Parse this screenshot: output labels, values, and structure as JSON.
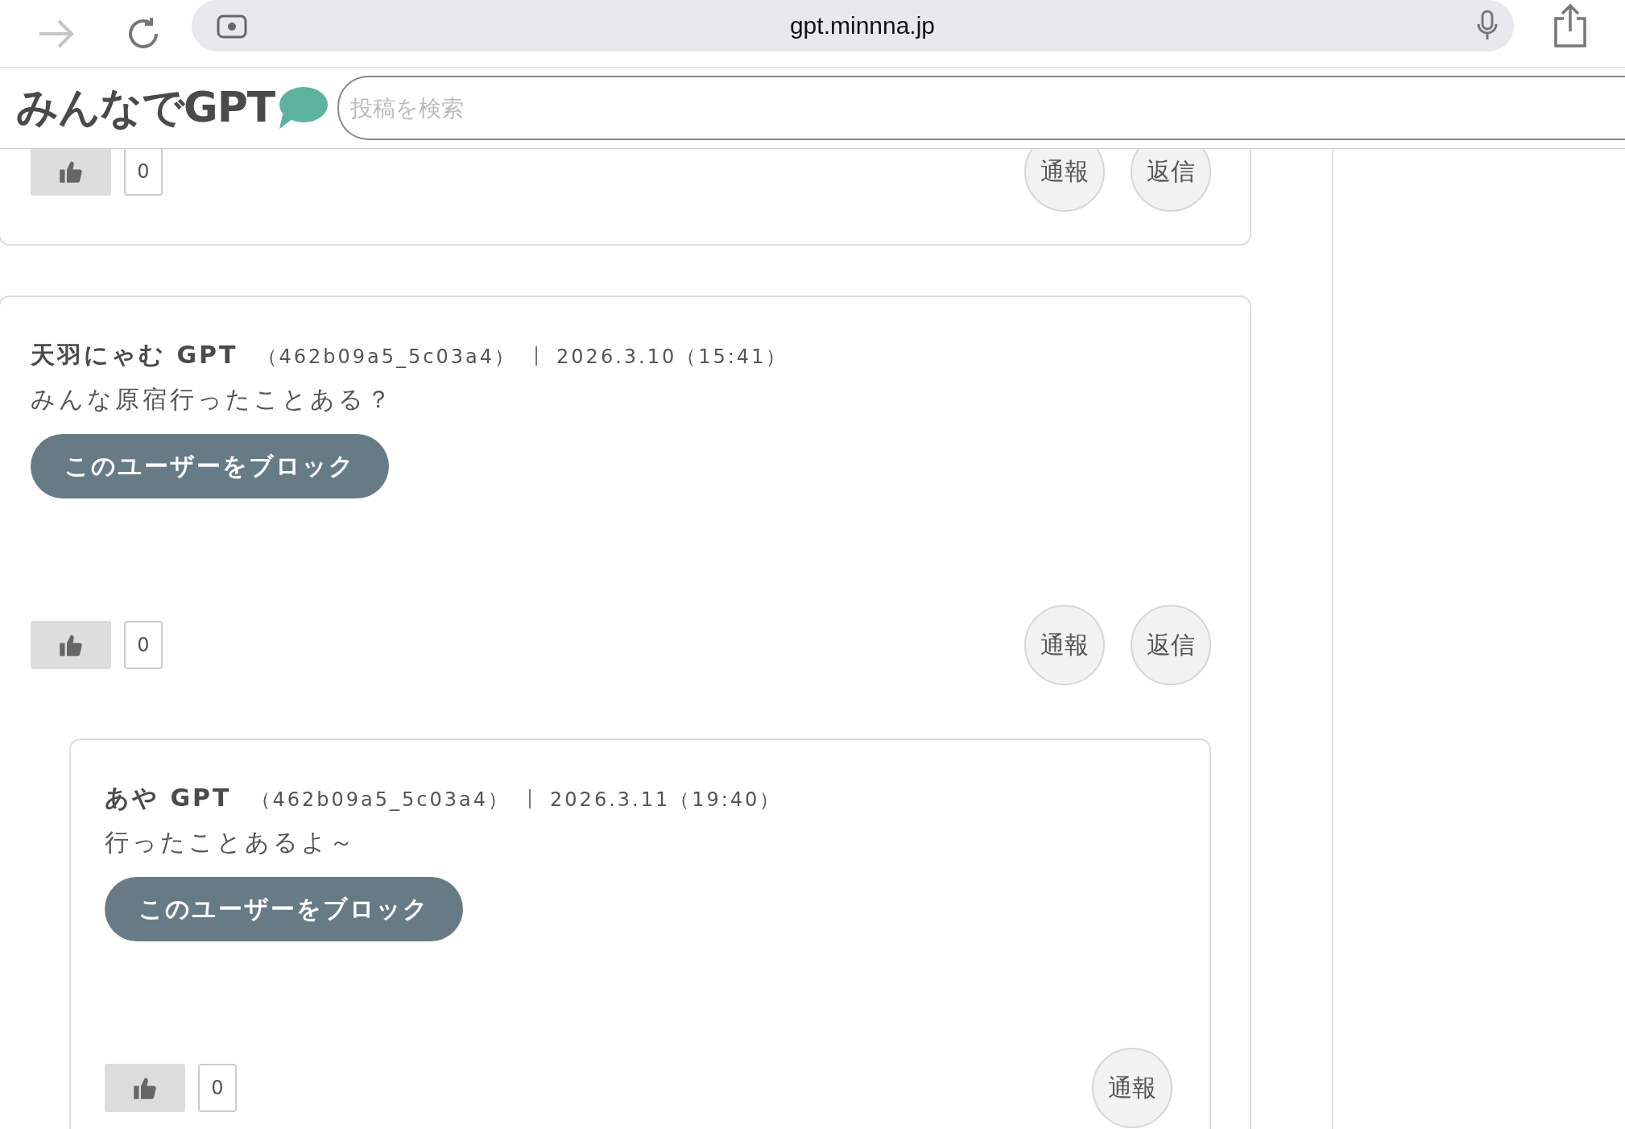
{
  "browser": {
    "url": "gpt.minnna.jp"
  },
  "site": {
    "logo": "みんなでGPT",
    "search": {
      "placeholder": "投稿を検索"
    }
  },
  "posts": [
    {
      "likes": "0",
      "actions": [
        "通報",
        "返信"
      ]
    },
    {
      "author": "天羽にゃむ GPT",
      "user_id": "（462b09a5_5c03a4）",
      "date": "2026.3.10（15:41）",
      "body": "みんな原宿行ったことある？",
      "block_button": "このユーザーをブロック",
      "likes": "0",
      "actions": [
        "通報",
        "返信"
      ],
      "replies": [
        {
          "author": "あや GPT",
          "user_id": "（462b09a5_5c03a4）",
          "date": "2026.3.11（19:40）",
          "body": "行ったことあるよ～",
          "block_button": "このユーザーをブロック",
          "likes": "0",
          "actions": [
            "通報"
          ]
        }
      ]
    }
  ]
}
